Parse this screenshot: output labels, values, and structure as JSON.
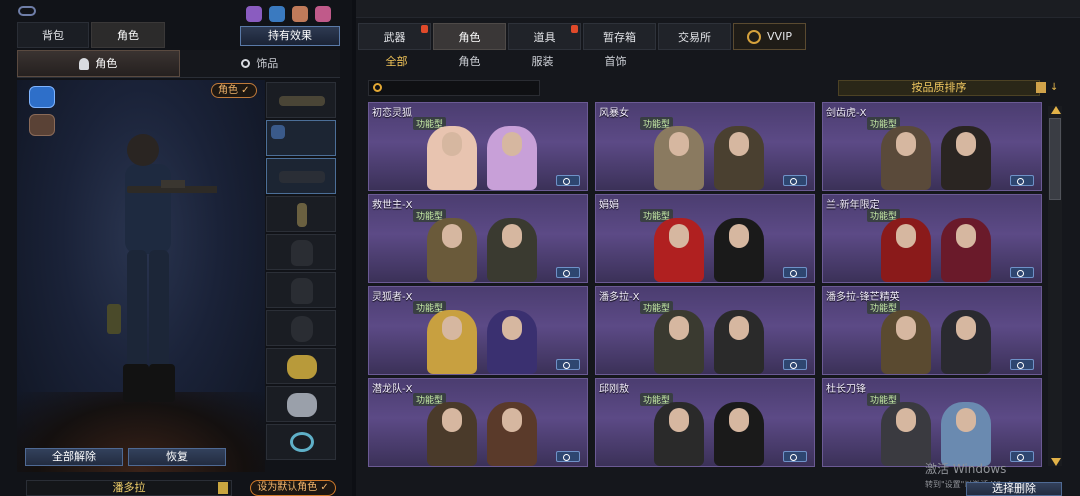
{
  "left": {
    "tabs": {
      "bag": "背包",
      "role": "角色"
    },
    "effects_button": "持有效果",
    "subtabs": {
      "role": "角色",
      "accessory": "饰品"
    },
    "role_badge": "角色 ✓",
    "buttons": {
      "remove_all": "全部解除",
      "restore": "恢复"
    },
    "character_name": "潘多拉",
    "default_button": "设为默认角色 ✓"
  },
  "right": {
    "main_tabs": [
      {
        "label": "武器",
        "hot": true
      },
      {
        "label": "角色",
        "hot": false,
        "active": true
      },
      {
        "label": "道具",
        "hot": true
      },
      {
        "label": "暂存箱",
        "hot": false
      },
      {
        "label": "交易所",
        "hot": false
      },
      {
        "label": "VVIP",
        "hot": false
      }
    ],
    "filter_tabs": [
      "全部",
      "角色",
      "服装",
      "首饰"
    ],
    "search": {
      "placeholder": ""
    },
    "sort_label": "按品质排序",
    "cards": [
      {
        "name": "初恋灵狐",
        "tag": "功能型"
      },
      {
        "name": "风暴女",
        "tag": "功能型"
      },
      {
        "name": "剑齿虎-X",
        "tag": "功能型"
      },
      {
        "name": "救世主-X",
        "tag": "功能型"
      },
      {
        "name": "娟娟",
        "tag": "功能型"
      },
      {
        "name": "兰-新年限定",
        "tag": "功能型"
      },
      {
        "name": "灵狐者-X",
        "tag": "功能型"
      },
      {
        "name": "潘多拉-X",
        "tag": "功能型"
      },
      {
        "name": "潘多拉-锋芒精英",
        "tag": "功能型"
      },
      {
        "name": "潜龙队-X",
        "tag": "功能型"
      },
      {
        "name": "邱刚敖",
        "tag": "功能型"
      },
      {
        "name": "杜长刀锋",
        "tag": "功能型"
      }
    ],
    "batch_delete_button": "选择删除",
    "watermark": {
      "line1": "激活 Windows",
      "line2": "转到\"设置\"以激活 Windows。"
    }
  },
  "colors": {
    "card_bg": "#5c4a86",
    "accent_gold": "#f0c860",
    "accent_orange": "#d07a2a"
  }
}
